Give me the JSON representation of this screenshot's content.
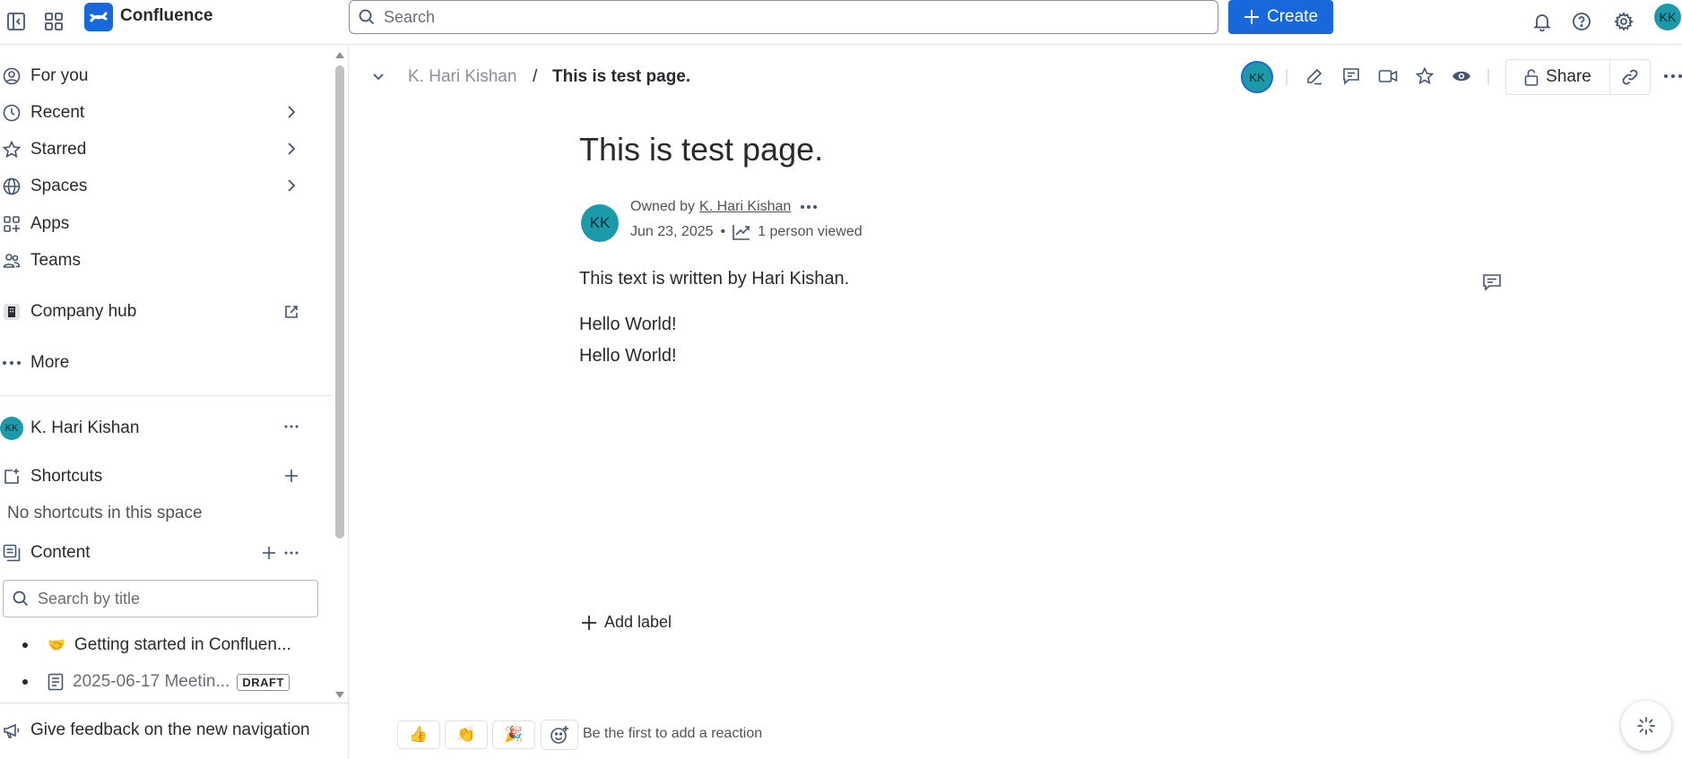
{
  "topbar": {
    "app_name": "Confluence",
    "search_placeholder": "Search",
    "create_label": "Create",
    "user_initials": "KK"
  },
  "sidebar": {
    "nav": [
      {
        "label": "For you",
        "icon": "user-circle-icon"
      },
      {
        "label": "Recent",
        "icon": "clock-icon"
      },
      {
        "label": "Starred",
        "icon": "star-icon"
      },
      {
        "label": "Spaces",
        "icon": "globe-icon"
      },
      {
        "label": "Apps",
        "icon": "apps-icon"
      },
      {
        "label": "Teams",
        "icon": "people-icon"
      },
      {
        "label": "Company hub",
        "icon": "building-icon"
      },
      {
        "label": "More",
        "icon": "more-icon"
      }
    ],
    "space": {
      "name": "K. Hari Kishan",
      "initials": "KK"
    },
    "shortcuts_label": "Shortcuts",
    "no_shortcuts": "No shortcuts in this space",
    "content_label": "Content",
    "title_search_placeholder": "Search by title",
    "tree": [
      {
        "emoji": "🤝",
        "label": "Getting started in Confluen..."
      },
      {
        "label": "2025-06-17 Meetin...",
        "badge": "DRAFT"
      }
    ],
    "feedback_label": "Give feedback on the new navigation"
  },
  "page": {
    "breadcrumb_root": "K. Hari Kishan",
    "breadcrumb_sep": "/",
    "breadcrumb_current": "This is test page.",
    "viewer_initials": "KK",
    "share_label": "Share",
    "title": "This is test page.",
    "owner_prefix": "Owned by",
    "owner_name": "K. Hari Kishan",
    "owner_initials": "KK",
    "date": "Jun 23, 2025",
    "meta_dot": "•",
    "views": "1 person viewed",
    "body": [
      "This text is written by Hari Kishan.",
      "Hello World!",
      "Hello World!"
    ],
    "add_label": "Add label",
    "reactions": [
      "👍",
      "👏",
      "🎉"
    ],
    "reaction_prompt": "Be the first to add a reaction"
  },
  "colors": {
    "brand": "#1868db",
    "avatar": "#1d9aaa"
  }
}
